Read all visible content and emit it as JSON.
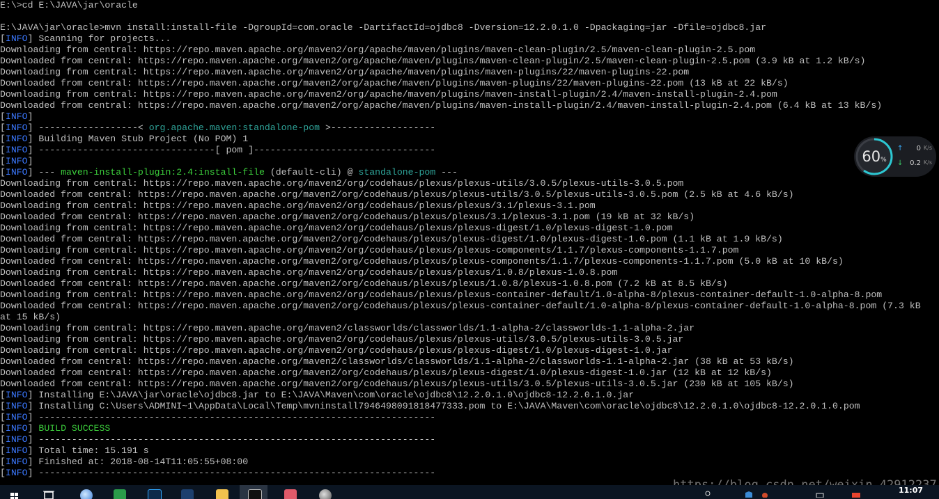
{
  "console": {
    "lines": [
      {
        "text": "E:\\>cd E:\\JAVA\\jar\\oracle"
      },
      {
        "text": ""
      },
      {
        "text": "E:\\JAVA\\jar\\oracle>mvn install:install-file -DgroupId=com.oracle -DartifactId=ojdbc8 -Dversion=12.2.0.1.0 -Dpackaging=jar -Dfile=ojdbc8.jar"
      },
      {
        "tag": "INFO",
        "text": " Scanning for projects..."
      },
      {
        "text": "Downloading from central: https://repo.maven.apache.org/maven2/org/apache/maven/plugins/maven-clean-plugin/2.5/maven-clean-plugin-2.5.pom"
      },
      {
        "text": "Downloaded from central: https://repo.maven.apache.org/maven2/org/apache/maven/plugins/maven-clean-plugin/2.5/maven-clean-plugin-2.5.pom (3.9 kB at 1.2 kB/s)"
      },
      {
        "text": "Downloading from central: https://repo.maven.apache.org/maven2/org/apache/maven/plugins/maven-plugins/22/maven-plugins-22.pom"
      },
      {
        "text": "Downloaded from central: https://repo.maven.apache.org/maven2/org/apache/maven/plugins/maven-plugins/22/maven-plugins-22.pom (13 kB at 22 kB/s)"
      },
      {
        "text": "Downloading from central: https://repo.maven.apache.org/maven2/org/apache/maven/plugins/maven-install-plugin/2.4/maven-install-plugin-2.4.pom"
      },
      {
        "text": "Downloaded from central: https://repo.maven.apache.org/maven2/org/apache/maven/plugins/maven-install-plugin/2.4/maven-install-plugin-2.4.pom (6.4 kB at 13 kB/s)"
      },
      {
        "tag": "INFO",
        "text": ""
      },
      {
        "tag": "INFO",
        "parts": [
          {
            "t": " ------------------< "
          },
          {
            "t": "org.apache.maven:standalone-pom",
            "c": "plug"
          },
          {
            "t": " >-------------------"
          }
        ]
      },
      {
        "tag": "INFO",
        "text": " Building Maven Stub Project (No POM) 1"
      },
      {
        "tag": "INFO",
        "text": " --------------------------------[ pom ]---------------------------------"
      },
      {
        "tag": "INFO",
        "text": ""
      },
      {
        "tag": "INFO",
        "parts": [
          {
            "t": " --- "
          },
          {
            "t": "maven-install-plugin:2.4:install-file",
            "c": "green"
          },
          {
            "t": " (default-cli) @ "
          },
          {
            "t": "standalone-pom",
            "c": "plug"
          },
          {
            "t": " ---"
          }
        ]
      },
      {
        "text": "Downloading from central: https://repo.maven.apache.org/maven2/org/codehaus/plexus/plexus-utils/3.0.5/plexus-utils-3.0.5.pom"
      },
      {
        "text": "Downloaded from central: https://repo.maven.apache.org/maven2/org/codehaus/plexus/plexus-utils/3.0.5/plexus-utils-3.0.5.pom (2.5 kB at 4.6 kB/s)"
      },
      {
        "text": "Downloading from central: https://repo.maven.apache.org/maven2/org/codehaus/plexus/plexus/3.1/plexus-3.1.pom"
      },
      {
        "text": "Downloaded from central: https://repo.maven.apache.org/maven2/org/codehaus/plexus/plexus/3.1/plexus-3.1.pom (19 kB at 32 kB/s)"
      },
      {
        "text": "Downloading from central: https://repo.maven.apache.org/maven2/org/codehaus/plexus/plexus-digest/1.0/plexus-digest-1.0.pom"
      },
      {
        "text": "Downloaded from central: https://repo.maven.apache.org/maven2/org/codehaus/plexus/plexus-digest/1.0/plexus-digest-1.0.pom (1.1 kB at 1.9 kB/s)"
      },
      {
        "text": "Downloading from central: https://repo.maven.apache.org/maven2/org/codehaus/plexus/plexus-components/1.1.7/plexus-components-1.1.7.pom"
      },
      {
        "text": "Downloaded from central: https://repo.maven.apache.org/maven2/org/codehaus/plexus/plexus-components/1.1.7/plexus-components-1.1.7.pom (5.0 kB at 10 kB/s)"
      },
      {
        "text": "Downloading from central: https://repo.maven.apache.org/maven2/org/codehaus/plexus/plexus/1.0.8/plexus-1.0.8.pom"
      },
      {
        "text": "Downloaded from central: https://repo.maven.apache.org/maven2/org/codehaus/plexus/plexus/1.0.8/plexus-1.0.8.pom (7.2 kB at 8.5 kB/s)"
      },
      {
        "text": "Downloading from central: https://repo.maven.apache.org/maven2/org/codehaus/plexus/plexus-container-default/1.0-alpha-8/plexus-container-default-1.0-alpha-8.pom"
      },
      {
        "text": "Downloaded from central: https://repo.maven.apache.org/maven2/org/codehaus/plexus/plexus-container-default/1.0-alpha-8/plexus-container-default-1.0-alpha-8.pom (7.3 kB"
      },
      {
        "text": "at 15 kB/s)"
      },
      {
        "text": "Downloading from central: https://repo.maven.apache.org/maven2/classworlds/classworlds/1.1-alpha-2/classworlds-1.1-alpha-2.jar"
      },
      {
        "text": "Downloading from central: https://repo.maven.apache.org/maven2/org/codehaus/plexus/plexus-utils/3.0.5/plexus-utils-3.0.5.jar"
      },
      {
        "text": "Downloading from central: https://repo.maven.apache.org/maven2/org/codehaus/plexus/plexus-digest/1.0/plexus-digest-1.0.jar"
      },
      {
        "text": "Downloaded from central: https://repo.maven.apache.org/maven2/classworlds/classworlds/1.1-alpha-2/classworlds-1.1-alpha-2.jar (38 kB at 53 kB/s)"
      },
      {
        "text": "Downloaded from central: https://repo.maven.apache.org/maven2/org/codehaus/plexus/plexus-digest/1.0/plexus-digest-1.0.jar (12 kB at 12 kB/s)"
      },
      {
        "text": "Downloaded from central: https://repo.maven.apache.org/maven2/org/codehaus/plexus/plexus-utils/3.0.5/plexus-utils-3.0.5.jar (230 kB at 105 kB/s)"
      },
      {
        "tag": "INFO",
        "text": " Installing E:\\JAVA\\jar\\oracle\\ojdbc8.jar to E:\\JAVA\\Maven\\com\\oracle\\ojdbc8\\12.2.0.1.0\\ojdbc8-12.2.0.1.0.jar"
      },
      {
        "tag": "INFO",
        "text": " Installing C:\\Users\\ADMINI~1\\AppData\\Local\\Temp\\mvninstall7946498091818477333.pom to E:\\JAVA\\Maven\\com\\oracle\\ojdbc8\\12.2.0.1.0\\ojdbc8-12.2.0.1.0.pom"
      },
      {
        "tag": "INFO",
        "text": " ------------------------------------------------------------------------"
      },
      {
        "tag": "INFO",
        "parts": [
          {
            "t": " "
          },
          {
            "t": "BUILD SUCCESS",
            "c": "green"
          }
        ]
      },
      {
        "tag": "INFO",
        "text": " ------------------------------------------------------------------------"
      },
      {
        "tag": "INFO",
        "text": " Total time: 15.191 s"
      },
      {
        "tag": "INFO",
        "text": " Finished at: 2018-08-14T11:05:55+08:00"
      },
      {
        "tag": "INFO",
        "text": " ------------------------------------------------------------------------"
      }
    ]
  },
  "speed_widget": {
    "percent": "60",
    "percent_unit": "%",
    "percent_value": 0.6,
    "upload": "0",
    "download": "0.2",
    "unit": "K/s",
    "up_arrow": "↑",
    "down_arrow": "↓"
  },
  "watermark": "https://blog.csdn.net/weixin_42912237",
  "taskbar": {
    "items": [
      "windows-start-icon",
      "task-view-icon",
      "ie-browser-icon",
      "wps-icon",
      "photoshop-icon",
      "app-me-icon",
      "file-explorer-icon",
      "cmd-icon",
      "eraser-app-icon",
      "media-app-icon"
    ],
    "clock": "11:07"
  }
}
